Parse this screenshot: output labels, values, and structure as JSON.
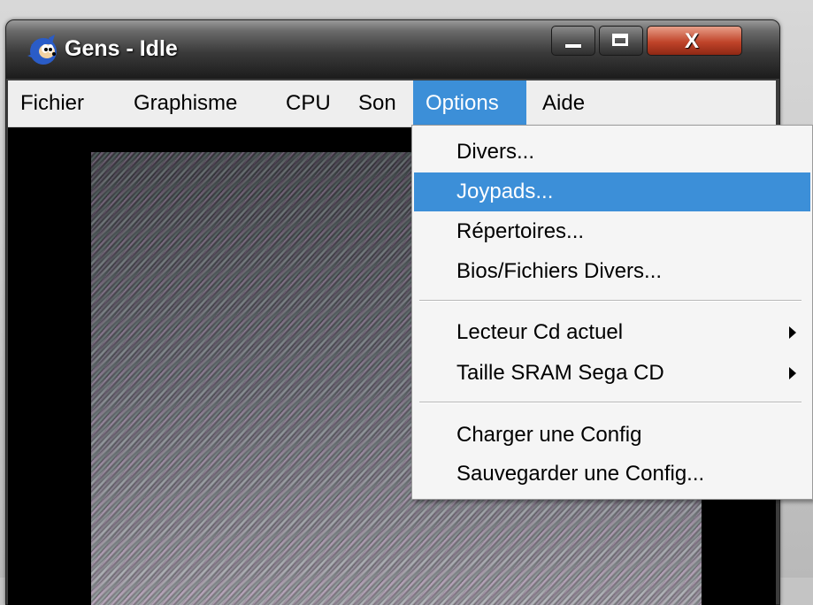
{
  "window": {
    "title": "Gens - Idle",
    "app_icon": "sonic-icon",
    "controls": {
      "minimize_icon": "minimize-icon",
      "maximize_icon": "maximize-icon",
      "close_label": "X"
    }
  },
  "menubar": {
    "items": [
      {
        "label": "Fichier"
      },
      {
        "label": "Graphisme"
      },
      {
        "label": "CPU"
      },
      {
        "label": "Son"
      },
      {
        "label": "Options",
        "active": true
      },
      {
        "label": "Aide"
      }
    ]
  },
  "options_menu": {
    "items": [
      {
        "label": "Divers..."
      },
      {
        "label": "Joypads...",
        "highlighted": true
      },
      {
        "label": "Répertoires..."
      },
      {
        "label": "Bios/Fichiers Divers..."
      },
      {
        "label": "Lecteur Cd actuel",
        "submenu": true
      },
      {
        "label": "Taille SRAM Sega CD",
        "submenu": true
      },
      {
        "label": "Charger une Config"
      },
      {
        "label": "Sauvegarder une Config..."
      }
    ]
  },
  "colors": {
    "highlight": "#3c8fd8",
    "menu_bg": "#f5f5f5",
    "menubar_bg": "#eeeeee",
    "title_text": "#ffffff",
    "close_button": "#c0442a"
  }
}
